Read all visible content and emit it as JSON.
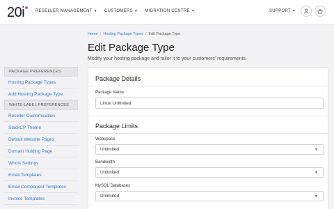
{
  "logo": {
    "text": "20i"
  },
  "nav": {
    "items": [
      {
        "label": "RESELLER MANAGEMENT"
      },
      {
        "label": "CUSTOMERS"
      },
      {
        "label": "MIGRATION CENTRE"
      }
    ],
    "support_label": "SUPPORT",
    "user_icon": "user-icon",
    "basket_icon": "basket-icon"
  },
  "breadcrumb": {
    "items": [
      "Home",
      "Hosting Package Types",
      "Edit Package Type"
    ],
    "separator": "/"
  },
  "page": {
    "title": "Edit Package Type",
    "subtitle": "Modify your hosting package and tailor it to your customers' requirements."
  },
  "sidebar": {
    "sections": [
      {
        "header": "PACKAGE PREFERENCES",
        "items": [
          "Hosting Package Types",
          "Add Hosting Package Type"
        ]
      },
      {
        "header": "WHITE-LABEL PREFERENCES",
        "items": [
          "Reseller Customisation",
          "StackCP Theme",
          "Default Website Pages",
          "Domain Holding Page",
          "Whois Settings",
          "Email Templates",
          "Email Component Templates",
          "Invoice Templates"
        ]
      }
    ]
  },
  "form": {
    "details_title": "Package Details",
    "package_name_label": "Package Name",
    "package_name_value": "Linux Unlimited",
    "limits_title": "Package Limits",
    "webspace_label": "Webspace",
    "webspace_value": "Unlimited",
    "bandwidth_label": "Bandwidth",
    "bandwidth_value": "Unlimited",
    "mysql_label": "MySQL Databases",
    "mysql_value": "Unlimited"
  },
  "colors": {
    "link": "#2f79c6",
    "logo_dot": "#e34f9c",
    "background": "#f2f2f4"
  }
}
